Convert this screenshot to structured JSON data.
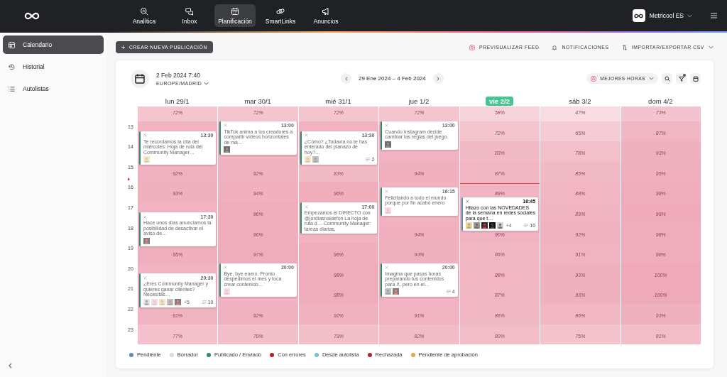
{
  "topbar": {
    "nav": [
      {
        "label": "Analítica",
        "selected": false
      },
      {
        "label": "Inbox",
        "selected": false
      },
      {
        "label": "Planificación",
        "selected": true
      },
      {
        "label": "SmartLinks",
        "selected": false
      },
      {
        "label": "Anuncios",
        "selected": false
      }
    ],
    "account": "Metricool ES"
  },
  "sidebar": {
    "items": [
      {
        "label": "Calendario",
        "selected": true
      },
      {
        "label": "Historial",
        "selected": false
      },
      {
        "label": "Autolistas",
        "selected": false
      }
    ]
  },
  "toolbar": {
    "create_button": "CREAR NUEVA PUBLICACIÓN",
    "actions": [
      {
        "label": "PREVISUALIZAR FEED",
        "dropdown": false
      },
      {
        "label": "NOTIFICACIONES",
        "dropdown": false
      },
      {
        "label": "IMPORTAR/EXPORTAR CSV",
        "dropdown": true
      }
    ]
  },
  "calendar": {
    "now": "2 Feb 2024 7:40",
    "timezone": "EUROPE/MADRID",
    "range": "29 Ene 2024 – 4 Feb 2024",
    "best_hours": "MEJORES HORAS",
    "filter_active": true,
    "hours": [
      "13",
      "14",
      "15",
      "16",
      "17",
      "18",
      "19",
      "20",
      "21",
      "22",
      "23"
    ],
    "days": [
      {
        "label": "lun 29/1",
        "today": false,
        "cells": [
          "72%",
          null,
          null,
          "92%",
          "93%",
          null,
          null,
          "95%",
          null,
          null,
          "91%",
          "77%"
        ],
        "posts": [
          {
            "time": "13:30",
            "text": "Te recordamos la cita del miércoles: Hoja de ruta del Community Manager…",
            "color": "#2e8b6e",
            "dimmed": true
          },
          {
            "time": "17:30",
            "text": "Hace unos días anunciamos la posibilidad de desactivar el aviso de…",
            "color": "#2e8b6e",
            "dimmed": true
          },
          {
            "time": "20:30",
            "text": "¿Eres Community Manager y quieres ganar clientes? Necesitas…",
            "color": "#2e8b6e",
            "dimmed": true,
            "extra": "+5",
            "comments": "10"
          }
        ]
      },
      {
        "label": "mar 30/1",
        "today": false,
        "cells": [
          "72%",
          null,
          null,
          "92%",
          "94%",
          "96%",
          "96%",
          "97%",
          null,
          null,
          "92%",
          "79%"
        ],
        "posts": [
          {
            "time": "13:00",
            "text": "TikTok anima a los creadores a compartir vídeos horizontales de má…",
            "color": "#2e8b6e",
            "dimmed": true
          },
          {
            "time": "20:00",
            "text": "Bye, bye enero. Pronto despedimos el mes y toca crear contenido…",
            "color": "#2e8b6e",
            "dimmed": true
          }
        ]
      },
      {
        "label": "mié 31/1",
        "today": false,
        "cells": [
          "72%",
          null,
          null,
          "83%",
          "96%",
          null,
          null,
          "96%",
          "98%",
          "98%",
          "92%",
          "79%"
        ],
        "posts": [
          {
            "time": "13:30",
            "text": "¿Cómo? ¿Todavía no te has enterado del planazo de hoy?…",
            "color": "#2e8b6e",
            "dimmed": true,
            "comments": "2"
          },
          {
            "time": "17:00",
            "text": "Empezamos el DIRECTO con @jordiasnaldefon La hoja de ruta d… Community Manager: tareas diarias,",
            "color": "#2e8b6e",
            "dimmed": true
          }
        ]
      },
      {
        "label": "jue 1/2",
        "today": false,
        "cells": [
          "72%",
          null,
          null,
          "94%",
          null,
          null,
          "94%",
          "93%",
          null,
          null,
          "91%",
          "82%"
        ],
        "posts": [
          {
            "time": "13:00",
            "text": "Cuando Instagram decide cambiar las reglas del juego.",
            "color": "#2e8b6e",
            "dimmed": true
          },
          {
            "time": "16:15",
            "text": "Felicitando a todo el mundo porque por fin acabó enero",
            "color": "#2e8b6e",
            "dimmed": true
          },
          {
            "time": "20:00",
            "text": "Imagina que pasas horas preparando tus contenidos para X, pero en el…",
            "color": "#2e8b6e",
            "dimmed": true,
            "comments": "4"
          }
        ]
      },
      {
        "label": "vie 2/2",
        "today": true,
        "cells": [
          "58%",
          "72%",
          "83%",
          "87%",
          "89%",
          null,
          "90%",
          "86%",
          "88%",
          "87%",
          "86%",
          "80%"
        ],
        "posts": [
          {
            "time": "16:45",
            "text": "Hilazo con las NOVEDADES de la semana en redes sociales para que t…",
            "color": "#5b8db8",
            "dimmed": false,
            "extra": "+4",
            "comments": "10"
          }
        ]
      },
      {
        "label": "sáb 3/2",
        "today": false,
        "cells": [
          "47%",
          "65%",
          "78%",
          "85%",
          "88%",
          "89%",
          "92%",
          "91%",
          "93%",
          "93%",
          "86%",
          "75%"
        ]
      },
      {
        "label": "dom 4/2",
        "today": false,
        "cells": [
          "73%",
          "87%",
          "93%",
          "95%",
          "98%",
          "99%",
          "98%",
          "98%",
          "100%",
          "100%",
          "93%",
          "81%"
        ]
      }
    ]
  },
  "legend": [
    {
      "label": "Pendiente",
      "color": "#5b8db8"
    },
    {
      "label": "Borrador",
      "color": "#d5d8dd"
    },
    {
      "label": "Publicado / Enviado",
      "color": "#2e8b6e"
    },
    {
      "label": "Con errores",
      "color": "#c0202a"
    },
    {
      "label": "Desde autolista",
      "color": "#6cc5d9"
    },
    {
      "label": "Rechazada",
      "color": "#b0262e"
    },
    {
      "label": "Pendiente de aprobación",
      "color": "#e0a84a"
    }
  ]
}
